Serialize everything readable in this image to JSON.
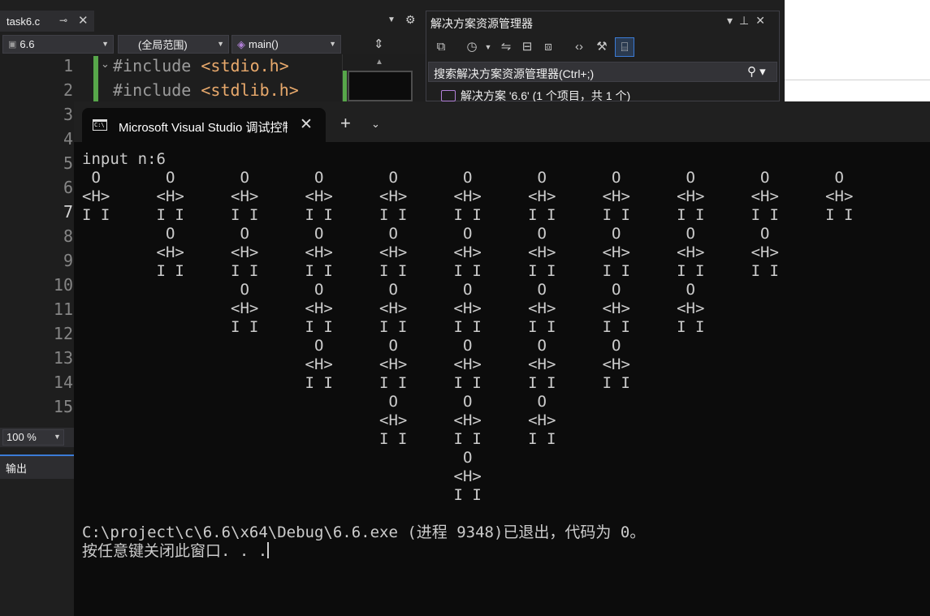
{
  "editor": {
    "file_tab": {
      "name": "task6.c",
      "pin_icon": "pin-icon",
      "close_icon": "close-icon"
    },
    "nav": {
      "project": "6.6",
      "scope": "(全局范围)",
      "function": "main()"
    },
    "line_numbers": [
      "1",
      "2",
      "3",
      "4",
      "5",
      "6",
      "7",
      "8",
      "9",
      "10",
      "11",
      "12",
      "13",
      "14",
      "15"
    ],
    "current_line": "7",
    "code": [
      {
        "keyword": "#include",
        "header": "<stdio.h>"
      },
      {
        "keyword": "#include",
        "header": "<stdlib.h>"
      }
    ],
    "zoom": "100 %",
    "output_label": "输出"
  },
  "solution_explorer": {
    "title": "解决方案资源管理器",
    "search_placeholder": "搜索解决方案资源管理器(Ctrl+;)",
    "solution_node": "解决方案 '6.6' (1 个项目，共 1 个)"
  },
  "terminal": {
    "tab_title": "Microsoft Visual Studio 调试控制台",
    "lines": [
      "input n:6",
      " O       O       O       O       O       O       O       O       O       O       O",
      "<H>     <H>     <H>     <H>     <H>     <H>     <H>     <H>     <H>     <H>     <H>",
      "I I     I I     I I     I I     I I     I I     I I     I I     I I     I I     I I",
      "         O       O       O       O       O       O       O       O       O",
      "        <H>     <H>     <H>     <H>     <H>     <H>     <H>     <H>     <H>",
      "        I I     I I     I I     I I     I I     I I     I I     I I     I I",
      "                 O       O       O       O       O       O       O",
      "                <H>     <H>     <H>     <H>     <H>     <H>     <H>",
      "                I I     I I     I I     I I     I I     I I     I I",
      "                         O       O       O       O       O",
      "                        <H>     <H>     <H>     <H>     <H>",
      "                        I I     I I     I I     I I     I I",
      "                                 O       O       O",
      "                                <H>     <H>     <H>",
      "                                I I     I I     I I",
      "                                         O",
      "                                        <H>",
      "                                        I I",
      "",
      "C:\\project\\c\\6.6\\x64\\Debug\\6.6.exe (进程 9348)已退出，代码为 0。"
    ],
    "prompt": "按任意键关闭此窗口. . ."
  }
}
